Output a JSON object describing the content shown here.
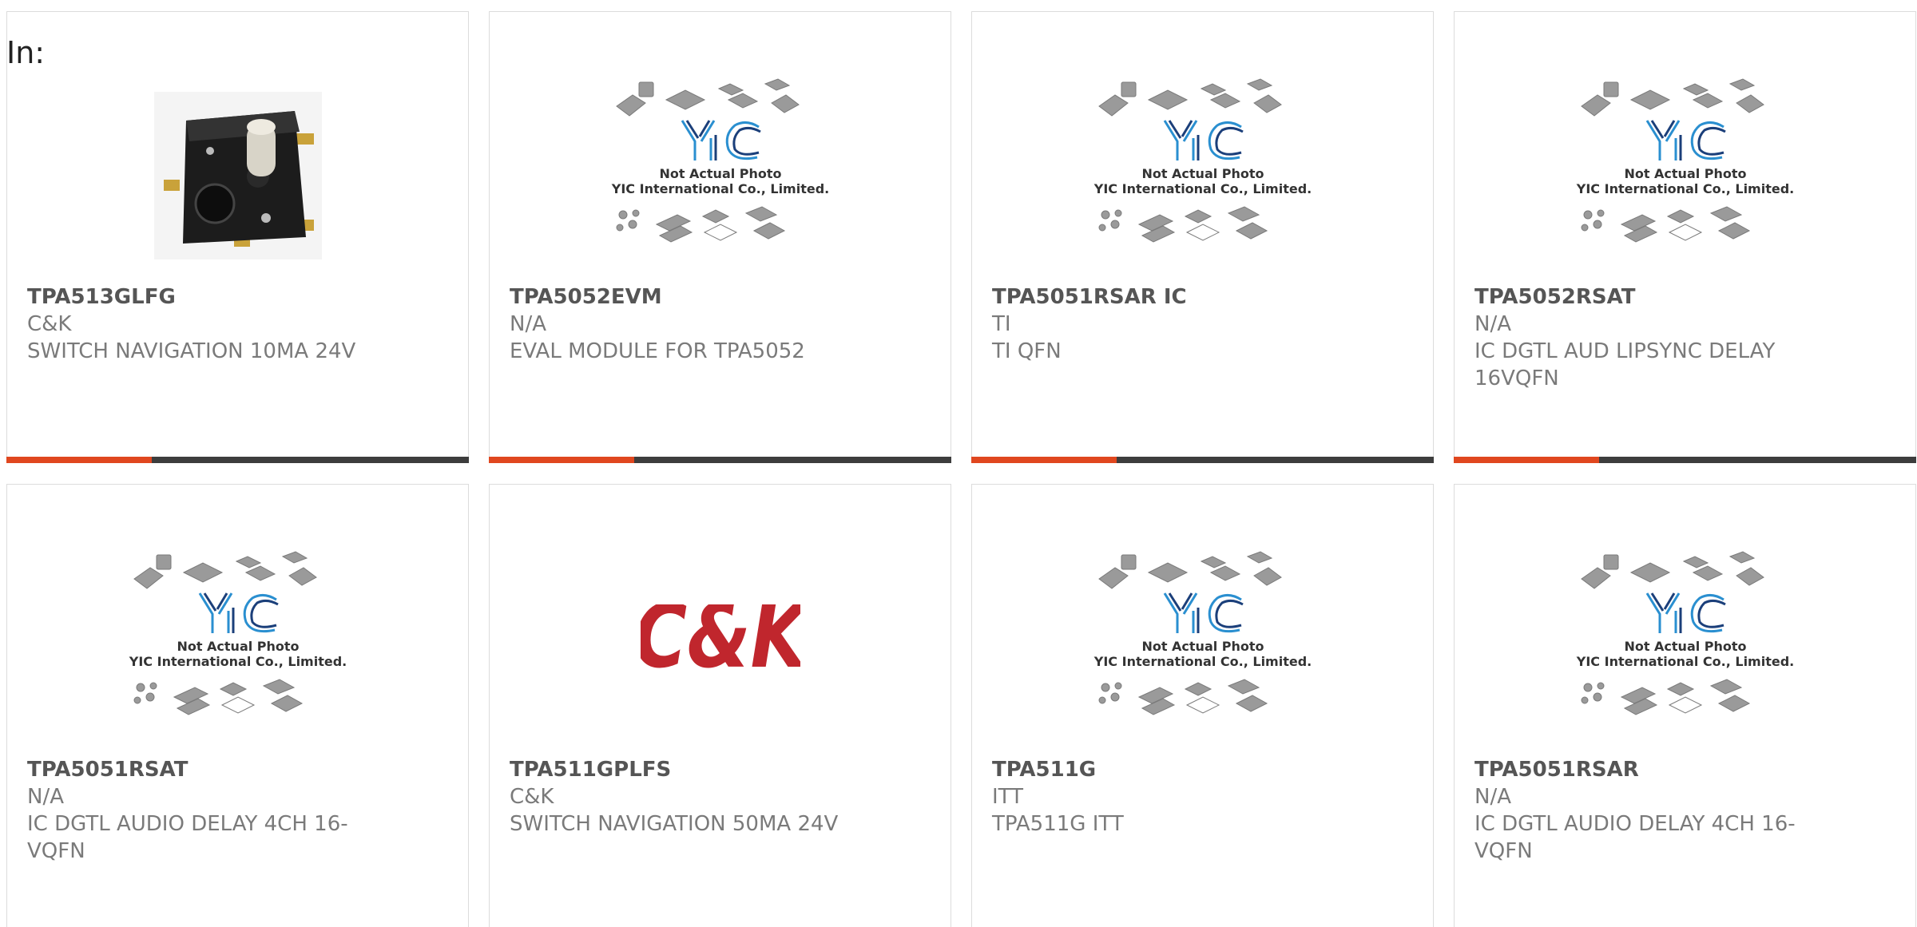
{
  "header": {
    "in_label": "In:"
  },
  "colors": {
    "accent": "#e0471f",
    "bar": "#3d3d3d",
    "yic_blue": "#2a8fd0",
    "ck_red": "#c0262d"
  },
  "placeholder_image": {
    "line1": "Not Actual Photo",
    "line2": "YIC International Co., Limited.",
    "logo": "YIC"
  },
  "ck_logo": {
    "text": "C&K"
  },
  "products": [
    {
      "part": "TPA513GLFG",
      "maker": "C&K",
      "desc": "SWITCH NAVIGATION 10MA 24V",
      "image": "switch-photo"
    },
    {
      "part": "TPA5052EVM",
      "maker": "N/A",
      "desc": "EVAL MODULE FOR TPA5052",
      "image": "yic-placeholder"
    },
    {
      "part": "TPA5051RSAR IC",
      "maker": "TI",
      "desc": "TI QFN",
      "image": "yic-placeholder"
    },
    {
      "part": "TPA5052RSAT",
      "maker": "N/A",
      "desc": "IC DGTL AUD LIPSYNC DELAY 16VQFN",
      "image": "yic-placeholder"
    },
    {
      "part": "TPA5051RSAT",
      "maker": "N/A",
      "desc": "IC DGTL AUDIO DELAY 4CH 16-VQFN",
      "image": "yic-placeholder"
    },
    {
      "part": "TPA511GPLFS",
      "maker": "C&K",
      "desc": "SWITCH NAVIGATION 50MA 24V",
      "image": "ck-logo"
    },
    {
      "part": "TPA511G",
      "maker": "ITT",
      "desc": "TPA511G ITT",
      "image": "yic-placeholder"
    },
    {
      "part": "TPA5051RSAR",
      "maker": "N/A",
      "desc": "IC DGTL AUDIO DELAY 4CH 16-VQFN",
      "image": "yic-placeholder"
    }
  ]
}
